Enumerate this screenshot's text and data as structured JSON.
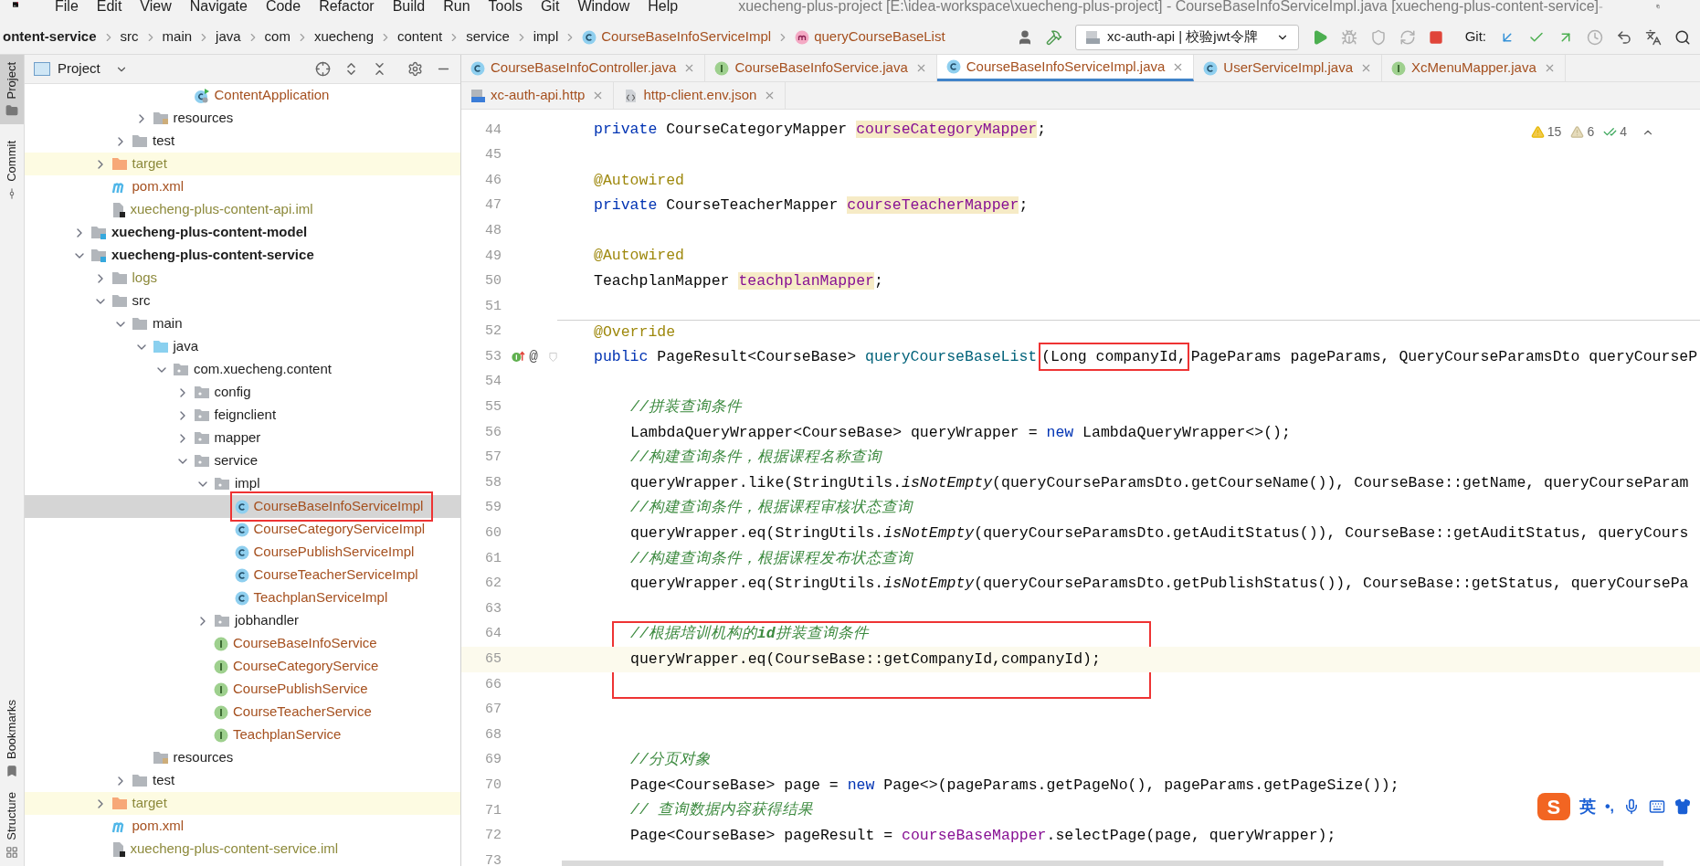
{
  "menu": [
    "File",
    "Edit",
    "View",
    "Navigate",
    "Code",
    "Refactor",
    "Build",
    "Run",
    "Tools",
    "Git",
    "Window",
    "Help"
  ],
  "window": {
    "title": "xuecheng-plus-project [E:\\idea-workspace\\xuecheng-plus-project] - CourseBaseInfoServiceImpl.java [xuecheng-plus-content-service]"
  },
  "breadcrumbs": [
    {
      "label": "ontent-service",
      "kind": "module"
    },
    {
      "label": "src",
      "kind": "folder"
    },
    {
      "label": "main",
      "kind": "folder"
    },
    {
      "label": "java",
      "kind": "folder"
    },
    {
      "label": "com",
      "kind": "folder"
    },
    {
      "label": "xuecheng",
      "kind": "folder"
    },
    {
      "label": "content",
      "kind": "folder"
    },
    {
      "label": "service",
      "kind": "folder"
    },
    {
      "label": "impl",
      "kind": "folder"
    },
    {
      "label": "CourseBaseInfoServiceImpl",
      "kind": "class"
    },
    {
      "label": "queryCourseBaseList",
      "kind": "method"
    }
  ],
  "run_config": {
    "value": "xc-auth-api | 校验jwt令牌"
  },
  "git_label": "Git:",
  "side_tabs": [
    {
      "label": "Project",
      "selected": true
    },
    {
      "label": "Commit",
      "selected": false
    },
    {
      "label": "Bookmarks",
      "selected": false
    },
    {
      "label": "Structure",
      "selected": false
    }
  ],
  "project_panel": {
    "title": "Project"
  },
  "tree": [
    {
      "children": [
        {
          "children": [
            {
              "children": [
                {
                  "children": [
                    {
                      "children": [
                        {
                          "label": "ContentApplication",
                          "kind": "app",
                          "color": "#a5501f",
                          "selected": false
                        }
                      ]
                    }
                  ]
                },
                {
                  "label": "resources",
                  "kind": "resources",
                  "color": "#1e1e1e",
                  "expanded": false,
                  "selected": false
                }
              ]
            },
            {
              "label": "test",
              "kind": "folder",
              "color": "#1e1e1e",
              "expanded": false,
              "selected": false
            }
          ]
        },
        {
          "label": "target",
          "kind": "excluded",
          "color": "#8d8a3c",
          "expanded": false,
          "selected": false
        },
        {
          "label": "pom.xml",
          "kind": "maven",
          "color": "#a5501f",
          "selected": false
        },
        {
          "label": "xuecheng-plus-content-api.iml",
          "kind": "iml",
          "color": "#8d8a3c",
          "selected": false
        }
      ]
    },
    {
      "label": "xuecheng-plus-content-model",
      "kind": "module",
      "color": "#1e1e1e",
      "expanded": false,
      "selected": false
    },
    {
      "label": "xuecheng-plus-content-service",
      "kind": "module",
      "color": "#1e1e1e",
      "expanded": true,
      "selected": false,
      "children": [
        {
          "label": "logs",
          "kind": "folder",
          "color": "#8d8a3c",
          "expanded": false,
          "selected": false
        },
        {
          "label": "src",
          "kind": "folder",
          "color": "#1e1e1e",
          "expanded": true,
          "selected": false,
          "children": [
            {
              "label": "main",
              "kind": "folder",
              "color": "#1e1e1e",
              "expanded": true,
              "selected": false,
              "children": [
                {
                  "label": "java",
                  "kind": "source",
                  "color": "#1e1e1e",
                  "expanded": true,
                  "selected": false,
                  "children": [
                    {
                      "label": "com.xuecheng.content",
                      "kind": "package",
                      "color": "#1e1e1e",
                      "expanded": true,
                      "selected": false,
                      "children": [
                        {
                          "label": "config",
                          "kind": "package",
                          "color": "#1e1e1e",
                          "expanded": false,
                          "selected": false
                        },
                        {
                          "label": "feignclient",
                          "kind": "package",
                          "color": "#1e1e1e",
                          "expanded": false,
                          "selected": false
                        },
                        {
                          "label": "mapper",
                          "kind": "package",
                          "color": "#1e1e1e",
                          "expanded": false,
                          "selected": false
                        },
                        {
                          "label": "service",
                          "kind": "package",
                          "color": "#1e1e1e",
                          "expanded": true,
                          "selected": false,
                          "children": [
                            {
                              "label": "impl",
                              "kind": "package",
                              "color": "#1e1e1e",
                              "expanded": true,
                              "selected": false,
                              "children": [
                                {
                                  "label": "CourseBaseInfoServiceImpl",
                                  "kind": "class",
                                  "color": "#a5501f",
                                  "selected": true,
                                  "boxed": true
                                },
                                {
                                  "label": "CourseCategoryServiceImpl",
                                  "kind": "class",
                                  "color": "#a5501f",
                                  "selected": false
                                },
                                {
                                  "label": "CoursePublishServiceImpl",
                                  "kind": "class",
                                  "color": "#a5501f",
                                  "selected": false
                                },
                                {
                                  "label": "CourseTeacherServiceImpl",
                                  "kind": "class",
                                  "color": "#a5501f",
                                  "selected": false
                                },
                                {
                                  "label": "TeachplanServiceImpl",
                                  "kind": "class",
                                  "color": "#a5501f",
                                  "selected": false
                                }
                              ]
                            },
                            {
                              "label": "jobhandler",
                              "kind": "package",
                              "color": "#1e1e1e",
                              "expanded": false,
                              "selected": false
                            },
                            {
                              "label": "CourseBaseInfoService",
                              "kind": "interface",
                              "color": "#a5501f",
                              "selected": false
                            },
                            {
                              "label": "CourseCategoryService",
                              "kind": "interface",
                              "color": "#a5501f",
                              "selected": false
                            },
                            {
                              "label": "CoursePublishService",
                              "kind": "interface",
                              "color": "#a5501f",
                              "selected": false
                            },
                            {
                              "label": "CourseTeacherService",
                              "kind": "interface",
                              "color": "#a5501f",
                              "selected": false
                            },
                            {
                              "label": "TeachplanService",
                              "kind": "interface",
                              "color": "#a5501f",
                              "selected": false
                            }
                          ]
                        }
                      ]
                    }
                  ]
                },
                {
                  "label": "resources",
                  "kind": "resources",
                  "color": "#1e1e1e",
                  "selected": false
                }
              ]
            },
            {
              "label": "test",
              "kind": "folder",
              "color": "#1e1e1e",
              "expanded": false,
              "selected": false
            }
          ]
        },
        {
          "label": "target",
          "kind": "excluded",
          "color": "#8d8a3c",
          "expanded": false,
          "selected": false
        },
        {
          "label": "pom.xml",
          "kind": "maven",
          "color": "#a5501f",
          "selected": false
        },
        {
          "label": "xuecheng-plus-content-service.iml",
          "kind": "iml",
          "color": "#8d8a3c",
          "selected": false
        }
      ]
    }
  ],
  "editor_tabs": [
    [
      {
        "label": "CourseBaseInfoController.java",
        "kind": "class",
        "selected": false
      },
      {
        "label": "CourseBaseInfoService.java",
        "kind": "interface",
        "selected": false
      },
      {
        "label": "CourseBaseInfoServiceImpl.java",
        "kind": "class",
        "selected": true
      },
      {
        "label": "UserServiceImpl.java",
        "kind": "class",
        "selected": false
      },
      {
        "label": "XcMenuMapper.java",
        "kind": "interface",
        "selected": false
      }
    ],
    [
      {
        "label": "xc-auth-api.http",
        "kind": "http",
        "selected": false
      },
      {
        "label": "http-client.env.json",
        "kind": "json",
        "selected": false
      }
    ]
  ],
  "inspections": [
    {
      "kind": "warning",
      "count": "15"
    },
    {
      "kind": "weak",
      "count": "6"
    },
    {
      "kind": "typo",
      "count": "4"
    }
  ],
  "code_lines": [
    {
      "number": "44",
      "kind": "member",
      "current": false,
      "segments": [
        {
          "text": "private",
          "kind": "keyword"
        },
        {
          "text": " CourseCategoryMapper ",
          "kind": "plain"
        },
        {
          "text": "courseCategoryMapper",
          "kind": "field"
        },
        {
          "text": ";",
          "kind": "plain"
        }
      ]
    },
    {
      "number": "45",
      "current": false
    },
    {
      "number": "46",
      "kind": "member",
      "current": false,
      "segments": [
        {
          "text": "@Autowired",
          "kind": "annotation"
        }
      ]
    },
    {
      "number": "47",
      "kind": "member",
      "current": false,
      "segments": [
        {
          "text": "private",
          "kind": "keyword"
        },
        {
          "text": " CourseTeacherMapper ",
          "kind": "plain"
        },
        {
          "text": "courseTeacherMapper",
          "kind": "field"
        },
        {
          "text": ";",
          "kind": "plain"
        }
      ]
    },
    {
      "number": "48",
      "current": false
    },
    {
      "number": "49",
      "kind": "member",
      "current": false,
      "segments": [
        {
          "text": "@Autowired",
          "kind": "annotation"
        }
      ]
    },
    {
      "number": "50",
      "kind": "member",
      "current": false,
      "segments": [
        {
          "text": "TeachplanMapper ",
          "kind": "plain"
        },
        {
          "text": "teachplanMapper",
          "kind": "field"
        },
        {
          "text": ";",
          "kind": "plain"
        }
      ]
    },
    {
      "number": "51",
      "current": false
    },
    {
      "number": "52",
      "kind": "member",
      "current": false,
      "separator": true,
      "segments": [
        {
          "text": "@Override",
          "kind": "annotation"
        }
      ]
    },
    {
      "number": "53",
      "kind": "member",
      "current": false,
      "gutter_text": "@",
      "segments": [
        {
          "text": "public",
          "kind": "keyword"
        },
        {
          "text": " PageResult<CourseBase> ",
          "kind": "plain"
        },
        {
          "text": "queryCourseBaseList",
          "kind": "method"
        },
        {
          "text": "(Long companyId,",
          "kind": "plain",
          "boxed": true
        },
        {
          "text": "PageParams pageParams, QueryCourseParamsDto queryCourseP",
          "kind": "plain"
        }
      ]
    },
    {
      "number": "54",
      "current": false
    },
    {
      "number": "55",
      "kind": "statement",
      "current": false,
      "segments": [
        {
          "text": "//拼装查询条件",
          "kind": "comment"
        }
      ]
    },
    {
      "number": "56",
      "kind": "statement",
      "current": false,
      "segments": [
        {
          "text": "LambdaQueryWrapper<CourseBase> queryWrapper = ",
          "kind": "plain"
        },
        {
          "text": "new",
          "kind": "keyword"
        },
        {
          "text": " LambdaQueryWrapper<>();",
          "kind": "plain"
        }
      ]
    },
    {
      "number": "57",
      "kind": "statement",
      "current": false,
      "segments": [
        {
          "text": "//构建查询条件，根据课程名称查询",
          "kind": "comment"
        }
      ]
    },
    {
      "number": "58",
      "kind": "statement",
      "current": false,
      "segments": [
        {
          "text": "queryWrapper.like(StringUtils.",
          "kind": "plain"
        },
        {
          "text": "isNotEmpty",
          "kind": "static"
        },
        {
          "text": "(queryCourseParamsDto.getCourseName()), CourseBase::getName, queryCourseParam",
          "kind": "plain"
        }
      ]
    },
    {
      "number": "59",
      "kind": "statement",
      "current": false,
      "segments": [
        {
          "text": "//构建查询条件，根据课程审核状态查询",
          "kind": "comment"
        }
      ]
    },
    {
      "number": "60",
      "kind": "statement",
      "current": false,
      "segments": [
        {
          "text": "queryWrapper.eq(StringUtils.",
          "kind": "plain"
        },
        {
          "text": "isNotEmpty",
          "kind": "static"
        },
        {
          "text": "(queryCourseParamsDto.getAuditStatus()), CourseBase::getAuditStatus, queryCours",
          "kind": "plain"
        }
      ]
    },
    {
      "number": "61",
      "kind": "statement",
      "current": false,
      "segments": [
        {
          "text": "//构建查询条件，根据课程发布状态查询",
          "kind": "comment"
        }
      ]
    },
    {
      "number": "62",
      "kind": "statement",
      "current": false,
      "segments": [
        {
          "text": "queryWrapper.eq(StringUtils.",
          "kind": "plain"
        },
        {
          "text": "isNotEmpty",
          "kind": "static"
        },
        {
          "text": "(queryCourseParamsDto.getPublishStatus()), CourseBase::getStatus, queryCoursePa",
          "kind": "plain"
        }
      ]
    },
    {
      "number": "63",
      "current": false
    },
    {
      "number": "64",
      "kind": "statement",
      "current": false,
      "boxed": true,
      "segments": [
        {
          "text": "//根据培训机构的**id**拼装查询条件",
          "kind": "comment"
        }
      ]
    },
    {
      "number": "65",
      "kind": "statement",
      "current": true,
      "boxed": true,
      "segments": [
        {
          "text": "queryWrapper.eq(CourseBase::getCompanyId,companyId);",
          "kind": "plain"
        }
      ]
    },
    {
      "number": "66",
      "current": false,
      "boxed": true
    },
    {
      "number": "67",
      "current": false
    },
    {
      "number": "68",
      "current": false
    },
    {
      "number": "69",
      "kind": "statement",
      "current": false,
      "segments": [
        {
          "text": "//分页对象",
          "kind": "comment"
        }
      ]
    },
    {
      "number": "70",
      "kind": "statement",
      "current": false,
      "segments": [
        {
          "text": "Page<CourseBase> page = ",
          "kind": "plain"
        },
        {
          "text": "new",
          "kind": "keyword"
        },
        {
          "text": " Page<>(pageParams.getPageNo(), pageParams.getPageSize());",
          "kind": "plain"
        }
      ]
    },
    {
      "number": "71",
      "kind": "statement",
      "current": false,
      "segments": [
        {
          "text": "// 查询数据内容获得结果",
          "kind": "comment"
        }
      ]
    },
    {
      "number": "72",
      "kind": "statement",
      "current": false,
      "segments": [
        {
          "text": "Page<CourseBase> pageResult = ",
          "kind": "plain"
        },
        {
          "text": "courseBaseMapper",
          "kind": "field_ref"
        },
        {
          "text": ".selectPage(page, queryWrapper);",
          "kind": "plain"
        }
      ]
    },
    {
      "number": "73",
      "current": false
    }
  ],
  "ime": {
    "logo": "S",
    "mode": "英",
    "punctuation": "•,"
  }
}
